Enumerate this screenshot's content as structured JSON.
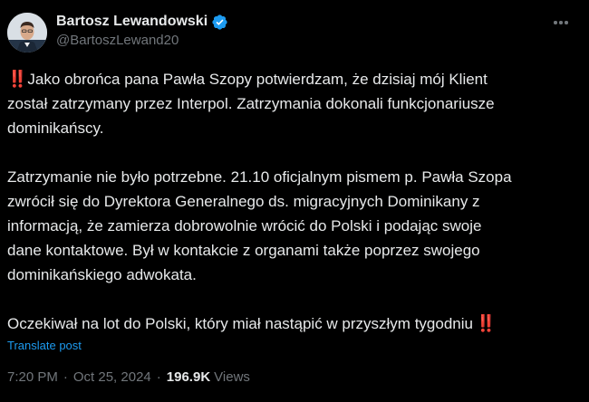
{
  "author": {
    "display_name": "Bartosz Lewandowski",
    "handle": "@BartoszLewand20",
    "verified": true,
    "verified_color": "#1d9bf0"
  },
  "tweet": {
    "emoji": "‼️",
    "paragraphs": [
      {
        "lead_emoji": true,
        "text": "Jako obrońca pana Pawła Szopy potwierdzam, że dzisiaj mój Klient\nzostał zatrzymany przez Interpol. Zatrzymania dokonali funkcjonariusze\ndominikańscy."
      },
      {
        "lead_emoji": false,
        "text": "Zatrzymanie nie było potrzebne. 21.10 oficjalnym pismem p. Pawła Szopa\nzwrócił się do Dyrektora Generalnego ds. migracyjnych Dominikany z\ninformacją, że zamierza dobrowolnie wrócić do Polski i podając swoje\ndane kontaktowe. Był w kontakcie z organami także poprzez swojego\ndominikańskiego adwokata."
      },
      {
        "lead_emoji": false,
        "trailing_emoji": true,
        "text": "Oczekiwał na lot do Polski, który miał nastąpić w przyszłym tygodniu"
      }
    ],
    "translate_label": "Translate post",
    "time": "7:20 PM",
    "separator": "·",
    "date": "Oct 25, 2024",
    "views_count": "196.9K",
    "views_label": "Views"
  },
  "icons": {
    "more": "more-horizontal-icon",
    "verified": "verified-badge-icon",
    "emoji": "double-exclamation-emoji"
  },
  "colors": {
    "background": "#000000",
    "text": "#e7e9ea",
    "secondary": "#71767b",
    "link": "#1d9bf0",
    "emoji_red": "#e0245e"
  }
}
